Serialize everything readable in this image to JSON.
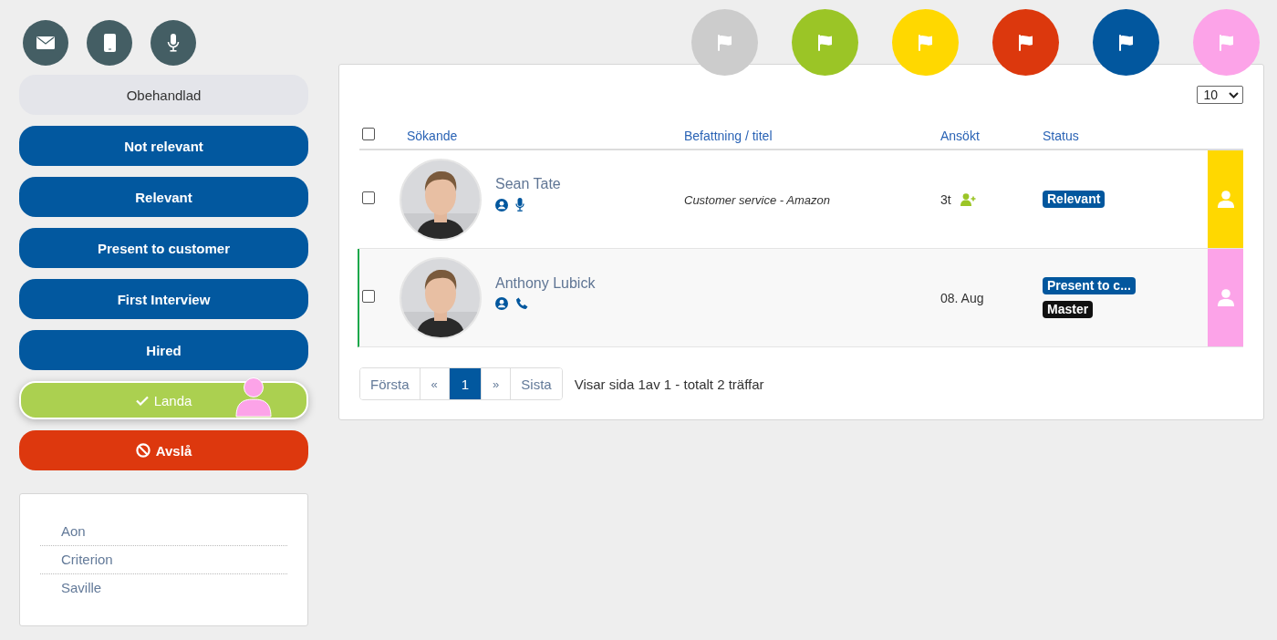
{
  "contact_buttons": [
    {
      "kind": "email"
    },
    {
      "kind": "phone"
    },
    {
      "kind": "voice"
    }
  ],
  "stages": [
    {
      "label": "Obehandlad",
      "kind": "neutral"
    },
    {
      "label": "Not relevant",
      "kind": "primary"
    },
    {
      "label": "Relevant",
      "kind": "primary"
    },
    {
      "label": "Present to customer",
      "kind": "primary"
    },
    {
      "label": "First Interview",
      "kind": "primary"
    },
    {
      "label": "Hired",
      "kind": "primary"
    },
    {
      "label": "Landa",
      "kind": "success",
      "marker": true
    },
    {
      "label": "Avslå",
      "kind": "danger"
    }
  ],
  "tests": [
    "Aon",
    "Criterion",
    "Saville"
  ],
  "flags": [
    {
      "color": "#cccccc"
    },
    {
      "color": "#9bc526"
    },
    {
      "color": "#ffd800"
    },
    {
      "color": "#dc380d"
    },
    {
      "color": "#02579e"
    },
    {
      "color": "#fca3e8"
    }
  ],
  "per_page": "10",
  "table": {
    "select_all_checked": false,
    "columns": [
      "Sökande",
      "Befattning / titel",
      "Ansökt",
      "Status"
    ],
    "rows": [
      {
        "checked": false,
        "selected": false,
        "name": "Sean Tate",
        "icons": [
          {
            "kind": "profile"
          },
          {
            "kind": "voice"
          }
        ],
        "title": "Customer service - Amazon",
        "applied": "3t",
        "assigned": true,
        "badges": [
          {
            "text": "Relevant",
            "color": "#02579e"
          }
        ],
        "color": "#ffd800"
      },
      {
        "checked": false,
        "selected": true,
        "name": "Anthony Lubick",
        "icons": [
          {
            "kind": "profile"
          },
          {
            "kind": "phone"
          }
        ],
        "applied": "08. Aug",
        "assigned": false,
        "badges": [
          {
            "text": "Present to c...",
            "color": "#02579e"
          },
          {
            "text": "Master",
            "color": "#111111"
          }
        ],
        "color": "#fca3e8"
      }
    ]
  },
  "pagination": {
    "pages": [
      {
        "label": "Första",
        "selected": false
      },
      {
        "label": "«",
        "selected": false
      },
      {
        "label": "1",
        "selected": true
      },
      {
        "label": "»",
        "selected": false
      },
      {
        "label": "Sista",
        "selected": false
      }
    ],
    "summary": "Visar sida 1av 1 - totalt 2 träffar"
  }
}
